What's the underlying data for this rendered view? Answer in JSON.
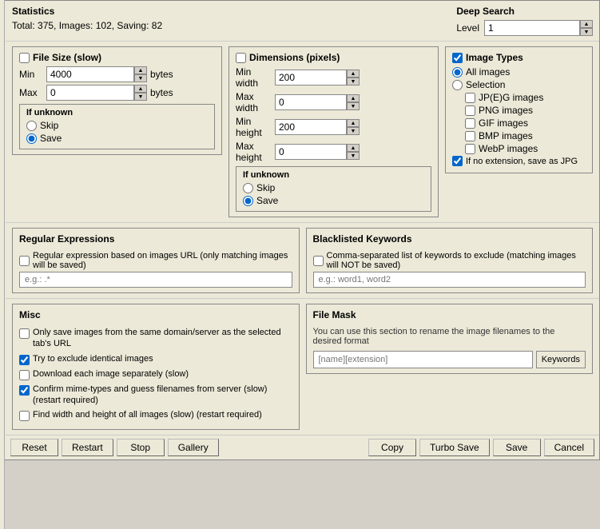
{
  "statistics": {
    "title": "Statistics",
    "text": "Total: 375, Images: 102, Saving: 82"
  },
  "deep_search": {
    "title": "Deep Search",
    "level_label": "Level",
    "level_value": "1"
  },
  "file_size": {
    "title": "File Size (slow)",
    "min_label": "Min",
    "min_value": "4000",
    "max_label": "Max",
    "max_value": "0",
    "unit": "bytes",
    "if_unknown_title": "If unknown",
    "skip_label": "Skip",
    "save_label": "Save"
  },
  "dimensions": {
    "title": "Dimensions (pixels)",
    "min_width_label": "Min width",
    "min_width_value": "200",
    "max_width_label": "Max width",
    "max_width_value": "0",
    "min_height_label": "Min height",
    "min_height_value": "200",
    "max_height_label": "Max height",
    "max_height_value": "0",
    "if_unknown_title": "If unknown",
    "skip_label": "Skip",
    "save_label": "Save"
  },
  "image_types": {
    "title": "Image Types",
    "all_images_label": "All images",
    "selection_label": "Selection",
    "jpeg_label": "JP(E)G images",
    "png_label": "PNG images",
    "gif_label": "GIF images",
    "bmp_label": "BMP images",
    "webp_label": "WebP images",
    "no_extension_label": "If no extension, save as JPG"
  },
  "regular_expressions": {
    "title": "Regular Expressions",
    "desc": "Regular expression based on images URL (only matching images will be saved)",
    "placeholder": "e.g.: .*"
  },
  "blacklisted_keywords": {
    "title": "Blacklisted Keywords",
    "desc": "Comma-separated list of keywords to exclude (matching images will NOT be saved)",
    "placeholder": "e.g.: word1, word2"
  },
  "misc": {
    "title": "Misc",
    "option1": "Only save images from the same domain/server as the selected tab's URL",
    "option2": "Try to exclude identical images",
    "option3": "Download each image separately (slow)",
    "option4": "Confirm mime-types and guess filenames from server (slow) (restart required)",
    "option5": "Find width and height of all images (slow) (restart required)"
  },
  "file_mask": {
    "title": "File Mask",
    "desc": "You can use this section to rename the image filenames to the desired format",
    "placeholder": "[name][extension]",
    "keywords_btn": "Keywords"
  },
  "bottom_bar": {
    "reset": "Reset",
    "restart": "Restart",
    "stop": "Stop",
    "gallery": "Gallery",
    "copy": "Copy",
    "turbo_save": "Turbo Save",
    "save": "Save",
    "cancel": "Cancel"
  }
}
